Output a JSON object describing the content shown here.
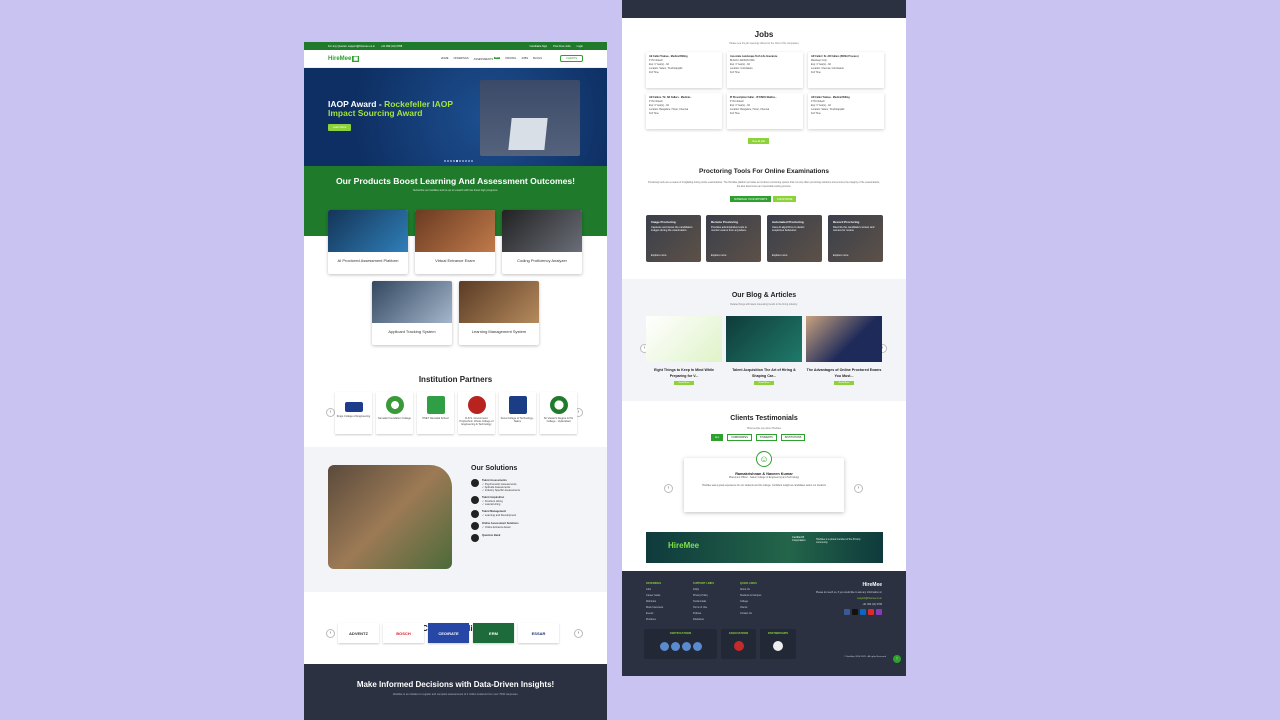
{
  "left": {
    "topbar": {
      "email": "For any Queries: support@hiremee.co.in",
      "phone": "+91 999 (44) 9788",
      "candidate": "Candidate Sign",
      "post_job": "Post Free Jobs",
      "login": "Login"
    },
    "nav": {
      "logo": "HireMee",
      "links": [
        "HOME",
        "OFFERINGS",
        "ASSESSMENTS",
        "PRICING",
        "JOBS",
        "BLOGS"
      ],
      "badge": "NEW",
      "cta": "CLIENTS"
    },
    "hero": {
      "title": "IAOP Award - ",
      "title_hl": "Rockefeller IAOP Impact Sourcing Award",
      "button": "Learn More"
    },
    "products": {
      "title": "Our Products Boost Learning And Assessment Outcomes!",
      "subtitle": "Subscribe our facilities and tie up to unearth with the finest high programs.",
      "items": [
        "AI Proctored Assessment Platform",
        "Virtual Entrance Exam",
        "Coding Proficiency Analyzer",
        "Applicant Tracking System",
        "Learning Management System"
      ]
    },
    "partners": {
      "title": "Institution Partners",
      "items": [
        "Kings College of Engineering",
        "Kamalar Foundation College",
        "PSET Namakal School",
        "R.D.S. Government Polytechnic, Dhule College of Engineering & Technology",
        "Sona College of Technology - Salem",
        "Sri Vasavi's Degree & PG College - Hyderabad"
      ]
    },
    "solutions": {
      "title": "Our Solutions",
      "items": [
        {
          "head": "Talent Assessments",
          "subs": [
            "Psychometric Assessments",
            "Aptitude Assessments",
            "Industry Specific Assessments"
          ]
        },
        {
          "head": "Talent Acquisition",
          "subs": [
            "Freshers Hiring",
            "Lateral Hiring"
          ]
        },
        {
          "head": "Talent Management",
          "subs": [
            "Learning and Development"
          ]
        },
        {
          "head": "Online Assessment Solutions",
          "subs": [
            "Online Entrance Exam"
          ]
        },
        {
          "head": "Question Bank",
          "subs": []
        }
      ]
    },
    "corporate": {
      "title": "Corporate Clients",
      "items": [
        "ADVENTZ",
        "BOSCH",
        "CEO/RATE",
        "ERM",
        "ESSAR"
      ]
    },
    "insights": {
      "title": "Make Informed Decisions with Data-Driven Insights!",
      "text": "HireMee is an initiative to register and complete assessments of 2 million students from over 7000 campuses."
    }
  },
  "right": {
    "jobs": {
      "title": "Jobs",
      "subtitle": "Please see the job openings offered to the Jobs of the companies",
      "button": "View all jobs",
      "items": [
        {
          "title": "AE Caller Trainee - Medical Billing",
          "co": "FYN Infotech",
          "exp": "Exp: 0 Year(s) - 0d",
          "loc": "Location: Salem, Tiruchirappalli",
          "type": "Full Time"
        },
        {
          "title": "Associate Landscape Tech Life Insurance",
          "co": "BLACK LANIKAN KMA",
          "exp": "Exp: 0 Year(s) - 0d",
          "loc": "Location: Coimbatore",
          "type": "Full Time"
        },
        {
          "title": "AR Caller / Sr. AR Callers (BCNA Process)",
          "co": "Mandeep Corp",
          "exp": "Exp: 0 Year(s) - 0d",
          "loc": "Location: Chennai, Coimbatore",
          "type": "Full Time"
        },
        {
          "title": "AR Callers / Sr. AR Callers - Medical...",
          "co": "FYN Infotech",
          "exp": "Exp: 0 Year(s) - 0d",
          "loc": "Location: Bangalore, Hosur, Chennai",
          "type": "Full Time"
        },
        {
          "title": "IP Prescription Caller - IP KSKK Medica...",
          "co": "FYN Infotech",
          "exp": "Exp: 0 Year(s) - 0d",
          "loc": "Location: Bangalore, Hosur, Chennai",
          "type": "Full Time"
        },
        {
          "title": "AR Caller Trainee - Medical Billing",
          "co": "FYN Infotech",
          "exp": "Exp: 0 Year(s) - 0d",
          "loc": "Location: Salem, Tiruchirappalli",
          "type": "Full Time"
        }
      ]
    },
    "proctoring": {
      "title": "Proctoring Tools For Online Examinations",
      "text": "Proctoring tools are a means of invigilating during online examinations. The HireMee platform provides an AI-driven proctoring system that not only offers proctoring solutions and ensures the integrity of the examinations, but also determines an impeccable testing process.",
      "btn1": "SCHEDULE YOUR APPOINTS",
      "btn2": "KNOW MORE",
      "tools": [
        {
          "name": "Image Proctoring",
          "text": "Captures and stores the candidate's images during the examination."
        },
        {
          "name": "Remote Proctoring",
          "text": "Provides administrative tools to monitor exams from anywhere."
        },
        {
          "name": "Automated Proctoring",
          "text": "Uses AI algorithms to detect suspicious behaviour."
        },
        {
          "name": "Record Proctoring",
          "text": "Records the candidate's screen and camera for review."
        }
      ],
      "explore": "Explore more"
    },
    "blog": {
      "title": "Our Blog & Articles",
      "subtitle": "Related blogs with latest interesting trends in the hiring industry.",
      "items": [
        "Eight Things to Keep In Mind While Preparing for V...",
        "Talent Acquisition The Art of Hiring & Shaping Car...",
        "The Advantages of Online Proctored Exams You Must..."
      ],
      "read": "Read More"
    },
    "testimonials": {
      "title": "Clients Testimonials",
      "subtitle": "What people say about HireMee",
      "tabs": [
        "ALL",
        "CORPORATES",
        "STUDENTS",
        "INSTITUTIONS"
      ],
      "name": "Ramakrishnan & Naveen Kumar",
      "role": "Placement Officer - Salem College of Engineering and Technology",
      "quote": "HireMee was a great experience for our students and the college. Confident insight as candidates select our students"
    },
    "banner": {
      "brand": "HireMee",
      "certified": "Certified B Corporation",
      "text": "HireMee is a proud member of the B Corp community."
    },
    "footer": {
      "col1": {
        "h": "OFFERINGS",
        "items": [
          "Jobs",
          "Career Guide",
          "Webinars",
          "Mock Interviews",
          "Events",
          "Practices"
        ]
      },
      "col2": {
        "h": "SUPPORT LINKS",
        "items": [
          "FAQs",
          "Privacy Policy",
          "Testimonials",
          "Terms of Use",
          "Policies",
          "Disclaimer"
        ]
      },
      "col3": {
        "h": "QUICK LINKS",
        "items": [
          "About Us",
          "Students & Campus",
          "College",
          "Clients",
          "Contact Us"
        ]
      },
      "contact": "Please do reach us, if you would like to ask any information on",
      "email": "support@hiremee.co.in",
      "phone": "+91 999 (44) 9788",
      "cert": "CERTIFICATIONS",
      "assoc": "ASSOCIATIONS",
      "partners": "PARTNERSHIPS",
      "copy": "© HireMee 2024-2025 - All rights Reserved"
    }
  }
}
